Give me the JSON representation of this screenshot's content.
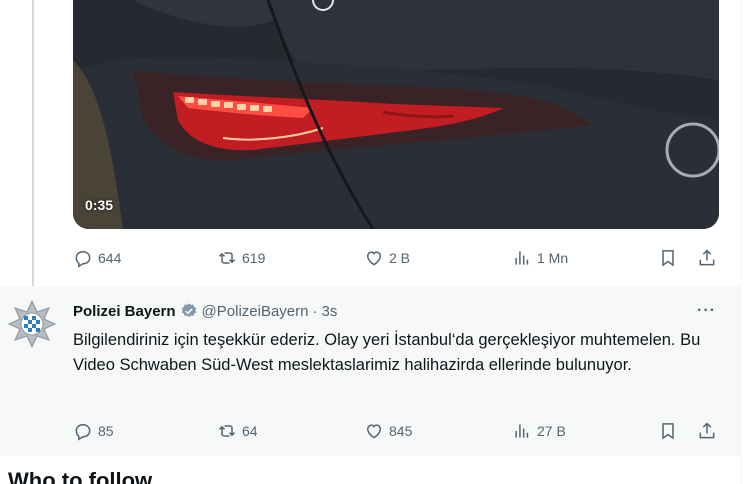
{
  "video": {
    "duration": "0:35"
  },
  "tweet1_actions": {
    "replies": "644",
    "retweets": "619",
    "likes": "2 B",
    "views": "1 Mn"
  },
  "tweet2": {
    "display_name": "Polizei Bayern",
    "handle": "@PolizeiBayern",
    "separator": "·",
    "time": "3s",
    "more": "···",
    "text": "Bilgilendiriniz için teşekkür ederiz. Olay yeri İstanbul‘da gerçekleşiyor muhtemelen. Bu Video Schwaben Süd-West meslektaslarimiz halihazirda ellerinde bulunuyor.",
    "actions": {
      "replies": "85",
      "retweets": "64",
      "likes": "845",
      "views": "27 B"
    }
  },
  "section_title": "Who to follow",
  "colors": {
    "text_primary": "#0f1419",
    "text_secondary": "#536471",
    "verified_badge": "#829aab",
    "background_highlight": "#f7f9f9"
  }
}
